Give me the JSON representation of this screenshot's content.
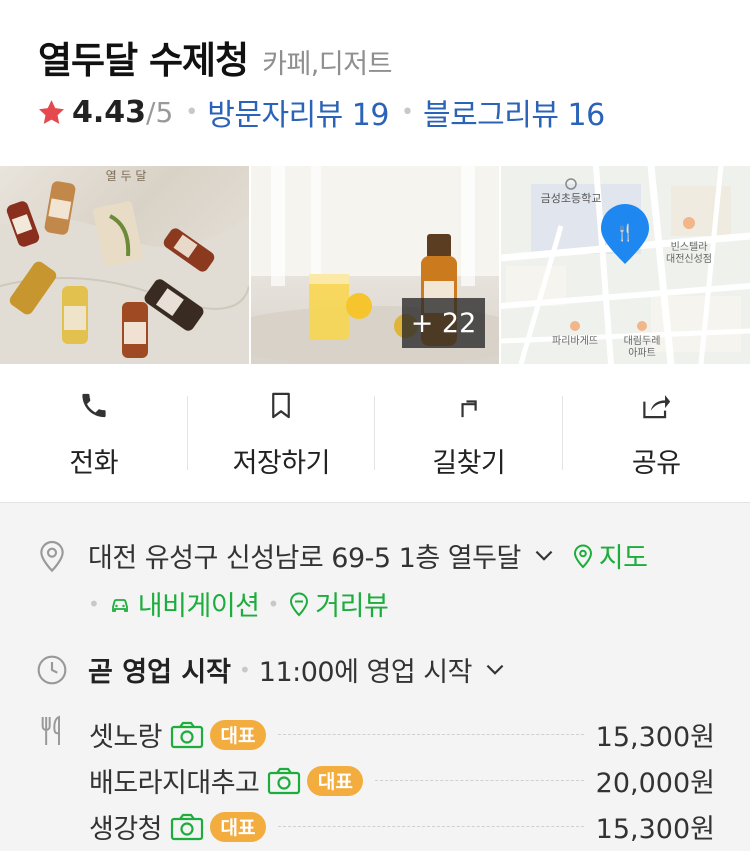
{
  "place": {
    "name": "열두달 수제청",
    "category": "카페,디저트",
    "rating": "4.43",
    "rating_max": "/5",
    "visitor_reviews": "방문자리뷰 19",
    "blog_reviews": "블로그리뷰 16"
  },
  "photos": {
    "first_label": "열 두 달",
    "more_count": "+ 22",
    "map_labels": {
      "school": "금성초등학교",
      "cafe": "빈스텔라\n대전신성점",
      "bakery": "파리바게뜨",
      "apartment": "대림두레\n아파트"
    }
  },
  "actions": [
    {
      "label": "전화",
      "icon": "phone-icon"
    },
    {
      "label": "저장하기",
      "icon": "bookmark-icon"
    },
    {
      "label": "길찾기",
      "icon": "directions-icon"
    },
    {
      "label": "공유",
      "icon": "share-icon"
    }
  ],
  "address": {
    "text": "대전 유성구 신성남로 69-5 1층 열두달",
    "map_link": "지도",
    "navigation_link": "내비게이션",
    "streetview_link": "거리뷰"
  },
  "hours": {
    "status": "곧 영업 시작",
    "detail": "11:00에 영업 시작"
  },
  "menu": [
    {
      "name": "셋노랑",
      "badge": "대표",
      "price": "15,300원"
    },
    {
      "name": "배도라지대추고",
      "badge": "대표",
      "price": "20,000원"
    },
    {
      "name": "생강청",
      "badge": "대표",
      "price": "15,300원"
    }
  ],
  "colors": {
    "link_blue": "#2a63b8",
    "green": "#1dad3d",
    "star_red": "#e5484d",
    "badge_orange": "#f3ad3f"
  }
}
